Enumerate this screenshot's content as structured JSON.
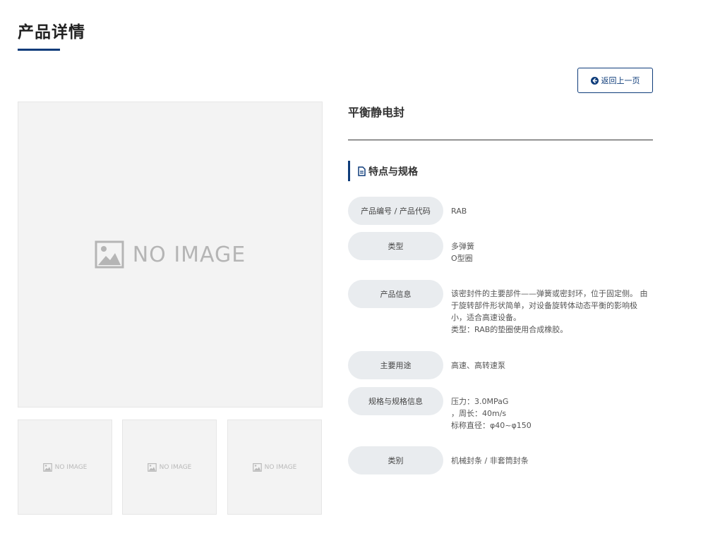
{
  "page": {
    "title": "产品详情"
  },
  "back_button": {
    "label": "返回上一页",
    "icon": "arrow-circle-left-icon"
  },
  "gallery": {
    "main_placeholder": "NO IMAGE",
    "thumbnails": [
      "NO IMAGE",
      "NO IMAGE",
      "NO IMAGE"
    ]
  },
  "product": {
    "name": "平衡静电封",
    "section_title": "特点与规格",
    "section_icon": "document-icon",
    "specs": [
      {
        "label": "产品编号 / 产品代码",
        "lines": [
          "RAB"
        ]
      },
      {
        "label": "类型",
        "lines": [
          "多弹簧",
          "O型圈"
        ]
      },
      {
        "label": "产品信息",
        "lines": [
          "该密封件的主要部件——弹簧或密封环，位于固定侧。 由",
          "于旋转部件形状简单，对设备旋转体动态平衡的影响极",
          "小，适合高速设备。",
          "类型：RAB的垫圈使用合成橡胶。"
        ]
      },
      {
        "label": "主要用途",
        "lines": [
          "高速、高转速泵"
        ]
      },
      {
        "label": "规格与规格信息",
        "lines": [
          "压力：3.0MPaG",
          "，周长：40m/s",
          "标称直径：φ40~φ150"
        ]
      },
      {
        "label": "类别",
        "lines": [
          "机械封条 / 非套筒封条"
        ]
      }
    ]
  },
  "colors": {
    "accent": "#0e3c7a",
    "label_bg": "#e9ecef",
    "placeholder_bg": "#f3f3f3"
  }
}
